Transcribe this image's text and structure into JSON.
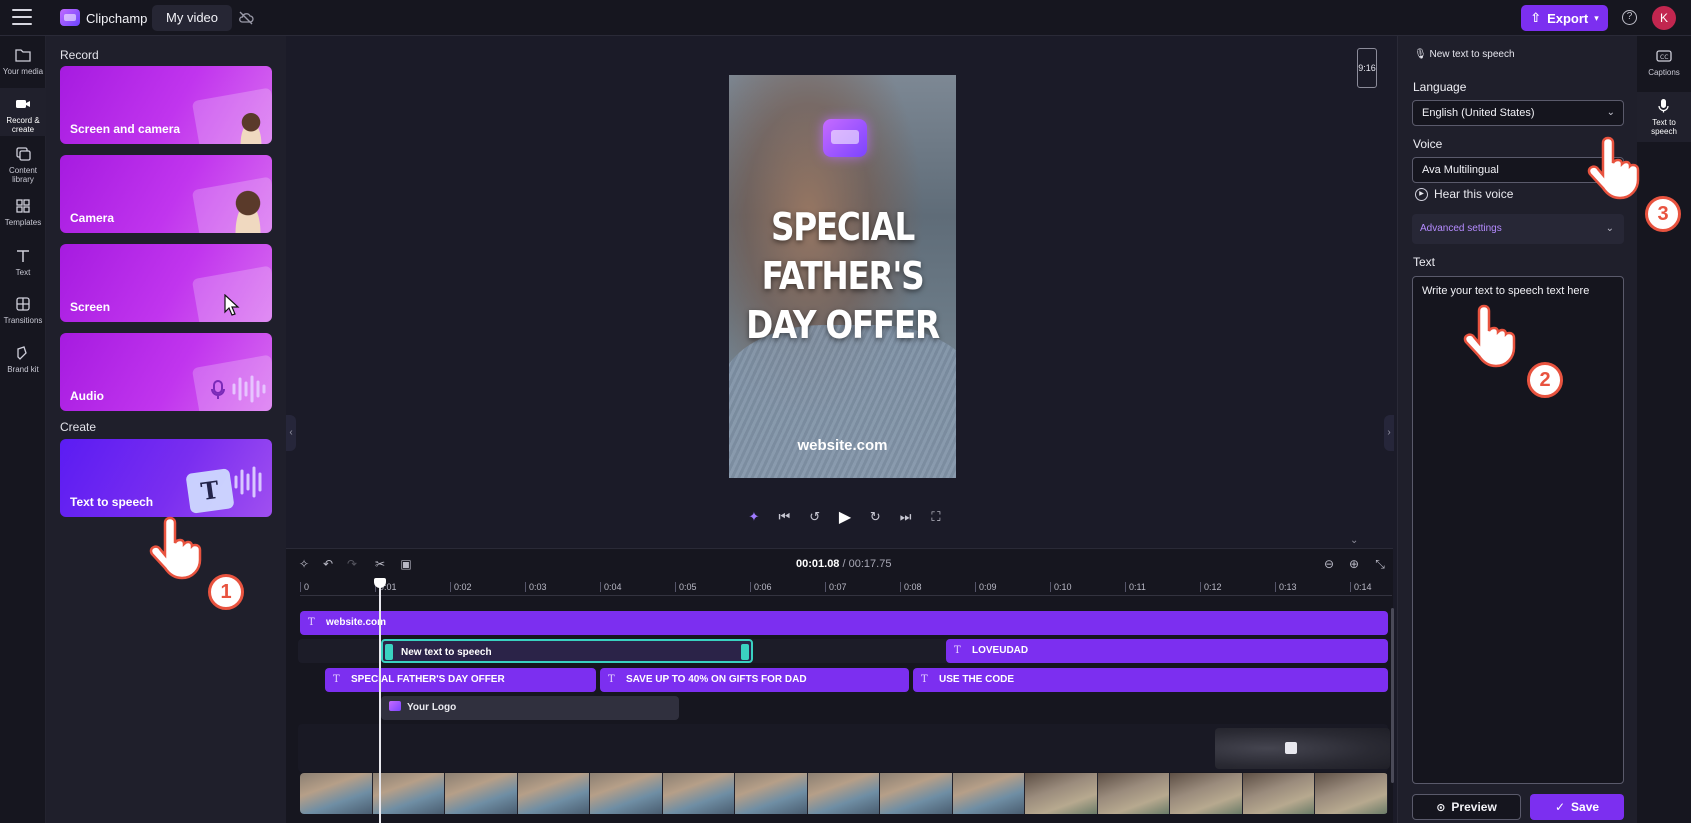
{
  "app": {
    "brand": "Clipchamp",
    "video_name": "My video",
    "export_label": "Export",
    "avatar_initial": "K",
    "help": "?"
  },
  "left_nav": {
    "items": [
      {
        "label": "Your media",
        "icon": "folder-icon"
      },
      {
        "label": "Record & create",
        "icon": "camera-icon",
        "active": true
      },
      {
        "label": "Content library",
        "icon": "library-icon"
      },
      {
        "label": "Templates",
        "icon": "templates-icon"
      },
      {
        "label": "Text",
        "icon": "text-icon"
      },
      {
        "label": "Transitions",
        "icon": "transitions-icon"
      },
      {
        "label": "Brand kit",
        "icon": "brand-kit-icon"
      }
    ]
  },
  "record_panel": {
    "record_heading": "Record",
    "cards": [
      {
        "label": "Screen and camera"
      },
      {
        "label": "Camera"
      },
      {
        "label": "Screen"
      },
      {
        "label": "Audio"
      }
    ],
    "create_heading": "Create",
    "tts_card": {
      "label": "Text to speech"
    }
  },
  "stage": {
    "aspect_ratio": "9:16",
    "headline": "SPECIAL FATHER'S DAY OFFER",
    "website": "website.com"
  },
  "timeline": {
    "current_time": "00:01.08",
    "total_time": "/ 00:17.75",
    "ticks": [
      "0",
      "0:01",
      "0:02",
      "0:03",
      "0:04",
      "0:05",
      "0:06",
      "0:07",
      "0:08",
      "0:09",
      "0:10",
      "0:11",
      "0:12",
      "0:13",
      "0:14"
    ],
    "clips": {
      "website": "website.com",
      "tts": "New text to speech",
      "lovedad": "LOVEUDAD",
      "special": "SPECIAL FATHER'S DAY OFFER",
      "save": "SAVE UP TO 40% ON GIFTS FOR DAD",
      "code": "USE THE CODE",
      "logo": "Your Logo"
    }
  },
  "tts_panel": {
    "title": "New text to speech",
    "language_label": "Language",
    "language_value": "English (United States)",
    "voice_label": "Voice",
    "voice_value": "Ava Multilingual",
    "hear_voice": "Hear this voice",
    "advanced": "Advanced settings",
    "text_label": "Text",
    "text_placeholder": "Write your text to speech text here",
    "preview_label": "Preview",
    "save_label": "Save"
  },
  "right_nav": {
    "items": [
      {
        "label": "Captions",
        "icon": "captions-icon"
      },
      {
        "label": "Text to speech",
        "icon": "tts-icon",
        "active": true
      }
    ]
  },
  "tutorial": {
    "steps": [
      "1",
      "2",
      "3"
    ]
  },
  "colors": {
    "accent": "#7c2ff0",
    "selection": "#3ad1c1",
    "tutorial_badge": "#e8533f"
  }
}
